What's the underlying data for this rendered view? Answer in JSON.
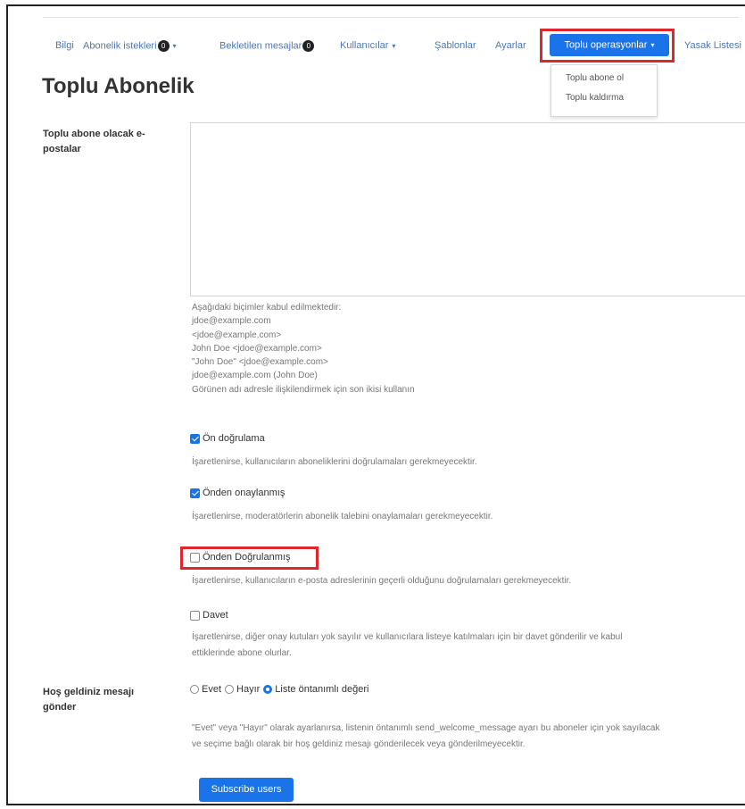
{
  "nav": {
    "items": [
      {
        "label": "Bilgi"
      },
      {
        "label": "Abonelik istekleri",
        "badge": "0",
        "has_caret": true
      },
      {
        "label": "Bekletilen mesajlar",
        "badge": "0"
      },
      {
        "label": "Kullanıcılar",
        "has_caret": true
      },
      {
        "label": "Şablonlar"
      },
      {
        "label": "Ayarlar"
      },
      {
        "label": "Toplu operasyonlar",
        "active": true,
        "has_caret": true
      },
      {
        "label": "Yasak Listesi"
      }
    ],
    "dropdown": [
      "Toplu abone ol",
      "Toplu kaldırma"
    ]
  },
  "page_title": "Toplu Abonelik",
  "emails_field": {
    "label": "Toplu abone olacak e-postalar",
    "value": "",
    "help_lines": [
      "Aşağıdaki biçimler kabul edilmektedir:",
      "jdoe@example.com",
      "<jdoe@example.com>",
      "John Doe <jdoe@example.com>",
      "\"John Doe\" <jdoe@example.com>",
      "jdoe@example.com (John Doe)",
      "Görünen adı adresle ilişkilendirmek için son ikisi kullanın"
    ]
  },
  "options": [
    {
      "label": "Ön doğrulama",
      "checked": true,
      "desc": "İşaretlenirse, kullanıcıların aboneliklerini doğrulamaları gerekmeyecektir."
    },
    {
      "label": "Önden onaylanmış",
      "checked": true,
      "desc": "İşaretlenirse, moderatörlerin abonelik talebini onaylamaları gerekmeyecektir."
    },
    {
      "label": "Önden Doğrulanmış",
      "checked": false,
      "desc": "İşaretlenirse, kullanıcıların e-posta adreslerinin geçerli olduğunu doğrulamaları gerekmeyecektir."
    },
    {
      "label": "Davet",
      "checked": false,
      "desc1": "İşaretlenirse, diğer onay kutuları yok sayılır ve kullanıcılara listeye katılmaları için bir davet gönderilir ve kabul",
      "desc2": "ettiklerinde abone olurlar."
    }
  ],
  "welcome": {
    "label": "Hoş geldiniz mesajı gönder",
    "radios": [
      {
        "label": "Evet",
        "selected": false
      },
      {
        "label": "Hayır",
        "selected": false
      },
      {
        "label": "Liste öntanımlı değeri",
        "selected": true
      }
    ],
    "help1": "\"Evet\" veya \"Hayır\" olarak ayarlanırsa, listenin öntanımlı send_welcome_message ayarı bu aboneler için yok sayılacak",
    "help2": "ve seçime bağlı olarak bir hoş geldiniz mesajı gönderilecek veya gönderilmeyecektir."
  },
  "submit_label": "Subscribe users",
  "colors": {
    "accent": "#1a73e8",
    "highlight": "#e0262d",
    "link": "#4a78b8"
  }
}
